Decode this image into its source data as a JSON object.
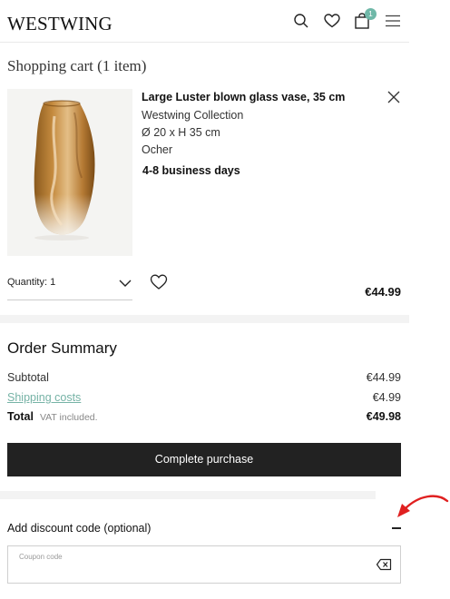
{
  "header": {
    "logo": "WESTWING",
    "cart_count": "1",
    "icons": [
      "search-icon",
      "heart-icon",
      "bag-icon",
      "menu-icon"
    ]
  },
  "cart": {
    "title": "Shopping cart (1 item)",
    "item": {
      "name": "Large Luster blown glass vase, 35 cm",
      "brand": "Westwing Collection",
      "dimensions": "Ø 20 x H 35 cm",
      "color": "Ocher",
      "delivery": "4-8 business days",
      "quantity_label": "Quantity: 1",
      "price": "€44.99"
    }
  },
  "summary": {
    "title": "Order Summary",
    "subtotal_label": "Subtotal",
    "subtotal_value": "€44.99",
    "shipping_label": "Shipping costs",
    "shipping_value": "€4.99",
    "total_label": "Total",
    "vat_note": "VAT included.",
    "total_value": "€49.98",
    "checkout_label": "Complete purchase"
  },
  "discount": {
    "title": "Add discount code (optional)",
    "placeholder": "Coupon code",
    "value": ""
  },
  "colors": {
    "accent": "#6fb8a8",
    "button": "#222222",
    "annotation": "#e02020"
  }
}
